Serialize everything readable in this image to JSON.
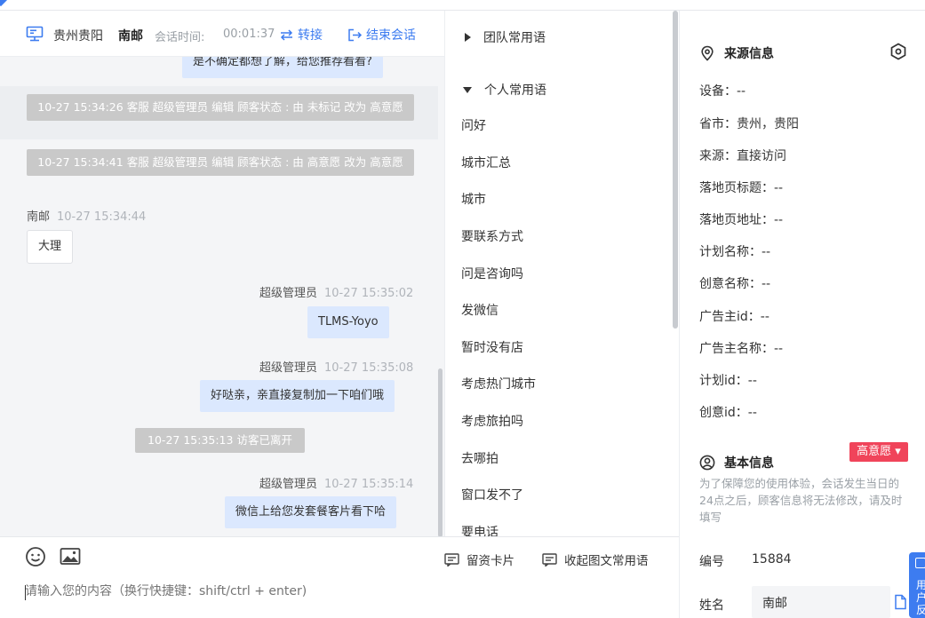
{
  "top_cut_text": "",
  "header": {
    "location": "贵州贵阳",
    "customer_name": "南邮",
    "duration_label": "会话时间:",
    "duration": "00:01:37",
    "transfer_label": "转接",
    "end_label": "结束会话"
  },
  "chat": {
    "partial_msg": "是不确定都想了解，给您推荐看看?",
    "system_msgs": [
      "10-27 15:34:26 客服 超级管理员 编辑 顾客状态 : 由 未标记 改为 高意愿",
      "10-27 15:34:41 客服 超级管理员 编辑 顾客状态 : 由 高意愿 改为 高意愿"
    ],
    "visitor": {
      "name": "南邮",
      "time": "10-27 15:34:44",
      "text": "大理"
    },
    "agent_msgs": [
      {
        "name": "超级管理员",
        "time": "10-27 15:35:02",
        "text": "TLMS-Yoyo"
      },
      {
        "name": "超级管理员",
        "time": "10-27 15:35:08",
        "text": "好哒亲，亲直接复制加一下咱们哦"
      },
      {
        "name": "超级管理员",
        "time": "10-27 15:35:14",
        "text": "微信上给您发套餐客片看下哈"
      }
    ],
    "leave_notice": "10-27 15:35:13 访客已离开"
  },
  "composer": {
    "placeholder": "请输入您的内容（换行快捷键：shift/ctrl + enter)",
    "card_label": "留资卡片",
    "collapse_label": "收起图文常用语"
  },
  "phrases": {
    "team_group": "团队常用语",
    "personal_group": "个人常用语",
    "items": [
      "问好",
      "城市汇总",
      "城市",
      "要联系方式",
      "问是咨询吗",
      "发微信",
      "暂时没有店",
      "考虑热门城市",
      "考虑旅拍吗",
      "去哪拍",
      "窗口发不了",
      "要电话"
    ]
  },
  "source_info": {
    "title": "来源信息",
    "rows": [
      "设备：--",
      "省市：贵州，贵阳",
      "来源：直接访问",
      "落地页标题：--",
      "落地页地址：--",
      "计划名称：--",
      "创意名称：--",
      "广告主id：--",
      "广告主名称：--",
      "计划id：--",
      "创意id：--"
    ]
  },
  "basic_info": {
    "title": "基本信息",
    "status_badge": "高意愿 ▾",
    "hint": "为了保障您的使用体验，会话发生当日的24点之后，顾客信息将无法修改，请及时填写",
    "id_label": "编号",
    "id_value": "15884",
    "name_label": "姓名",
    "name_value": "南邮"
  },
  "float_tab": {
    "text": "用户反"
  },
  "colors": {
    "accent": "#3d7cf0",
    "agent_bubble": "#dbe8fe",
    "system_msg": "#c9c9c9",
    "badge": "#f0445a"
  }
}
